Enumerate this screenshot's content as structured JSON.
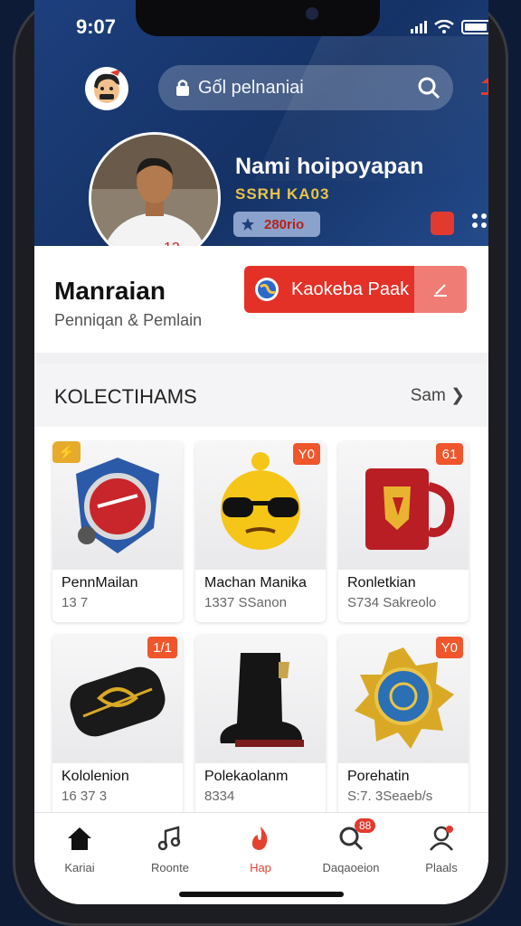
{
  "status_bar": {
    "time": "9:07"
  },
  "search": {
    "placeholder": "Gốl pelnaniai"
  },
  "profile": {
    "name": "Nami hoipoyapan",
    "subtitle": "SSRH KA03",
    "pill_value": "280rio"
  },
  "main": {
    "title": "Manraian",
    "subtitle": "Penniqan & Pemlain",
    "action_label": "Kaokeba Paak"
  },
  "collections": {
    "title": "KOLECTIHAMS",
    "see_all": "Sam",
    "items": [
      {
        "name": "PennMailan",
        "meta": "13 7",
        "badge": "",
        "icon": "shield-icon"
      },
      {
        "name": "Machan Manika",
        "meta": "1337 SSanon",
        "badge": "Y0",
        "icon": "emoji-sunglasses-icon"
      },
      {
        "name": "Ronletkian",
        "meta": "S734 Sakreolo",
        "badge": "61",
        "icon": "mug-icon"
      },
      {
        "name": "Kololenion",
        "meta": "16 37 3",
        "badge": "1/1",
        "icon": "captain-armband-icon"
      },
      {
        "name": "Polekaolanm",
        "meta": "8334",
        "badge": "",
        "icon": "boot-icon"
      },
      {
        "name": "Porehatin",
        "meta": "S:7. 3Seaeb/s",
        "badge": "Y0",
        "icon": "medal-icon"
      }
    ]
  },
  "tabs": [
    {
      "label": "Kariai",
      "icon": "home-icon"
    },
    {
      "label": "Roonte",
      "icon": "music-icon"
    },
    {
      "label": "Hap",
      "icon": "flame-icon"
    },
    {
      "label": "Daqaoeion",
      "icon": "search-icon",
      "badge": "88"
    },
    {
      "label": "Plaals",
      "icon": "user-icon"
    }
  ],
  "colors": {
    "accent": "#e43127",
    "hero": "#1d3f7d",
    "gold": "#e9c447"
  }
}
